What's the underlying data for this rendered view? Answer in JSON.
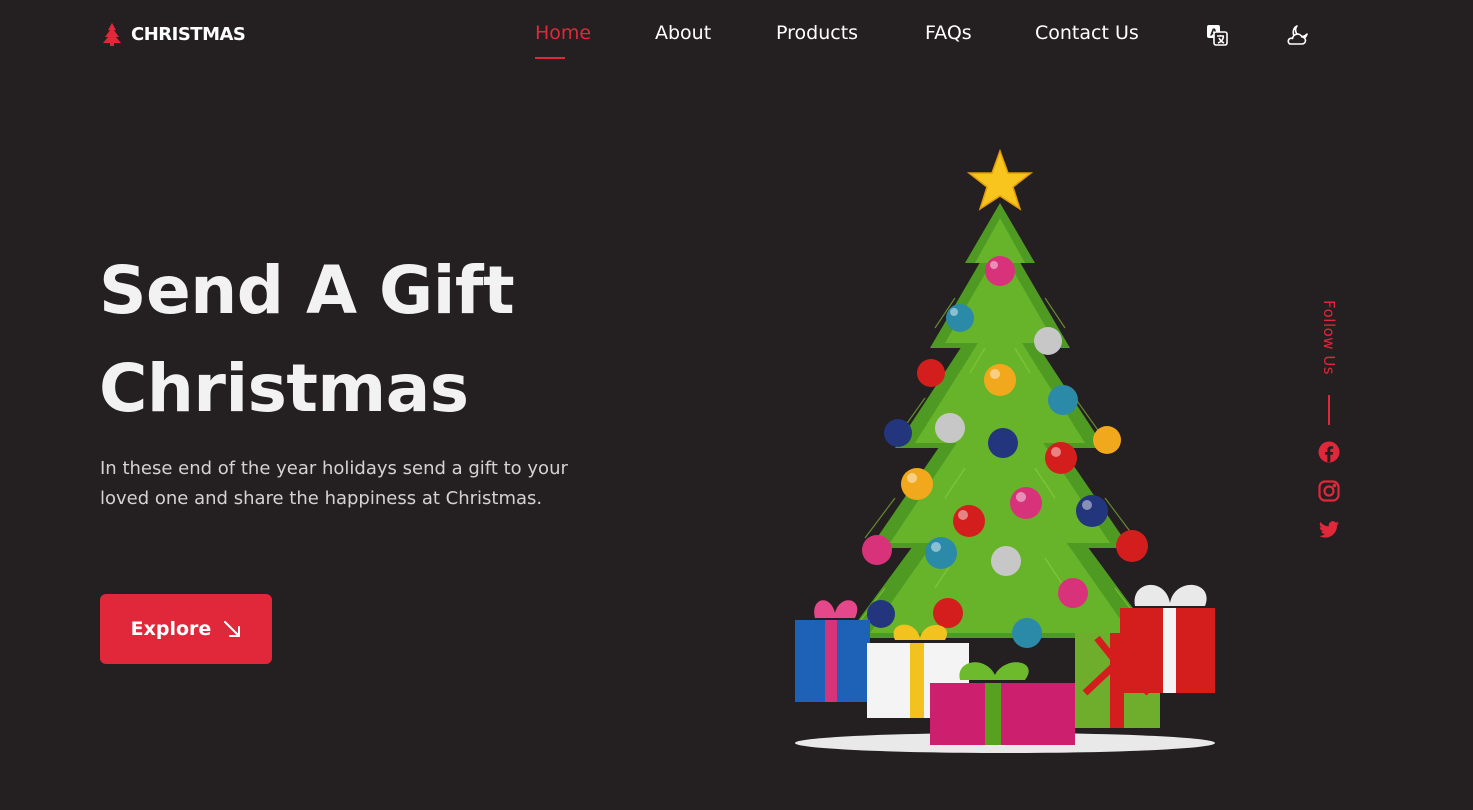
{
  "header": {
    "logo_text": "CHRISTMAS",
    "nav": [
      {
        "label": "Home",
        "active": true
      },
      {
        "label": "About"
      },
      {
        "label": "Products"
      },
      {
        "label": "FAQs"
      },
      {
        "label": "Contact Us"
      }
    ],
    "icons": [
      "translate-icon",
      "theme-moon-cloud-icon"
    ]
  },
  "hero": {
    "title_line1": "Send A Gift",
    "title_line2": "Christmas",
    "description": "In these end of the year holidays send a gift to your loved one and share the happiness at Christmas.",
    "button_label": "Explore",
    "button_icon": "arrow-down-right-icon"
  },
  "social": {
    "label": "Follow Us",
    "icons": [
      "facebook-icon",
      "instagram-icon",
      "twitter-icon"
    ]
  },
  "colors": {
    "background": "#241f20",
    "accent": "#e0283a",
    "text": "#f2f2f2"
  }
}
